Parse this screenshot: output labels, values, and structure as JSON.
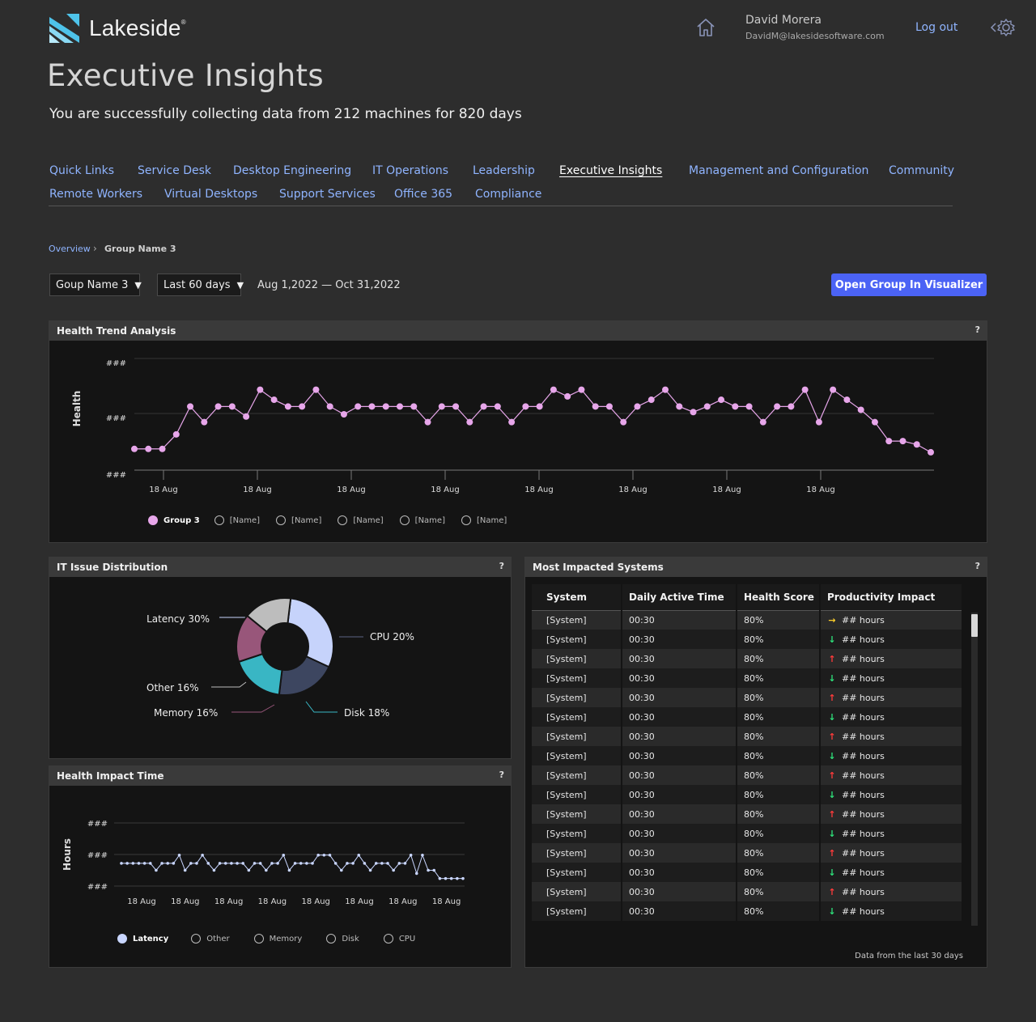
{
  "header": {
    "brand": "Lakeside",
    "user_name": "David Morera",
    "user_email": "DavidM@lakesidesoftware.com",
    "logout_label": "Log out",
    "icons": [
      "home-icon",
      "gear-icon"
    ]
  },
  "page": {
    "title": "Executive Insights",
    "subtitle": "You are successfully collecting data from 212 machines for 820 days"
  },
  "nav": {
    "row1": [
      "Quick Links",
      "Service Desk",
      "Desktop Engineering",
      "IT Operations",
      "Leadership",
      "Executive Insights",
      "Management and Configuration",
      "Community"
    ],
    "row2": [
      "Remote Workers",
      "Virtual Desktops",
      "Support Services",
      "Office 365",
      "Compliance"
    ],
    "active": "Executive Insights"
  },
  "breadcrumb": {
    "root": "Overview",
    "current": "Group Name 3"
  },
  "controls": {
    "group_select": "Goup Name 3",
    "period_select": "Last 60 days",
    "date_range": "Aug 1,2022 — Oct 31,2022",
    "open_button": "Open Group In Visualizer"
  },
  "health_trend": {
    "title": "Health Trend Analysis",
    "help": "?",
    "ylabel": "Health",
    "ytick_labels": [
      "###",
      "###",
      "###"
    ],
    "xtick_labels": [
      "18 Aug",
      "18 Aug",
      "18 Aug",
      "18 Aug",
      "18 Aug",
      "18 Aug",
      "18 Aug",
      "18 Aug"
    ],
    "legend": [
      "Group 3",
      "[Name]",
      "[Name]",
      "[Name]",
      "[Name]",
      "[Name]"
    ]
  },
  "issue_distribution": {
    "title": "IT Issue Distribution",
    "help": "?"
  },
  "impact_time": {
    "title": "Health Impact Time",
    "help": "?",
    "ylabel": "Hours",
    "ytick_labels": [
      "###",
      "###",
      "###"
    ],
    "xtick_labels": [
      "18 Aug",
      "18 Aug",
      "18 Aug",
      "18 Aug",
      "18 Aug",
      "18 Aug",
      "18 Aug",
      "18 Aug"
    ],
    "legend": [
      "Latency",
      "Other",
      "Memory",
      "Disk",
      "CPU"
    ]
  },
  "impacted": {
    "title": "Most Impacted Systems",
    "help": "?",
    "columns": [
      "System",
      "Daily Active Time",
      "Health Score",
      "Productivity Impact"
    ],
    "rows": [
      {
        "system": "[System]",
        "time": "00:30",
        "score": "80%",
        "trend": "flat",
        "impact": "## hours"
      },
      {
        "system": "[System]",
        "time": "00:30",
        "score": "80%",
        "trend": "down",
        "impact": "## hours"
      },
      {
        "system": "[System]",
        "time": "00:30",
        "score": "80%",
        "trend": "up",
        "impact": "## hours"
      },
      {
        "system": "[System]",
        "time": "00:30",
        "score": "80%",
        "trend": "down",
        "impact": "## hours"
      },
      {
        "system": "[System]",
        "time": "00:30",
        "score": "80%",
        "trend": "up",
        "impact": "## hours"
      },
      {
        "system": "[System]",
        "time": "00:30",
        "score": "80%",
        "trend": "down",
        "impact": "## hours"
      },
      {
        "system": "[System]",
        "time": "00:30",
        "score": "80%",
        "trend": "up",
        "impact": "## hours"
      },
      {
        "system": "[System]",
        "time": "00:30",
        "score": "80%",
        "trend": "down",
        "impact": "## hours"
      },
      {
        "system": "[System]",
        "time": "00:30",
        "score": "80%",
        "trend": "up",
        "impact": "## hours"
      },
      {
        "system": "[System]",
        "time": "00:30",
        "score": "80%",
        "trend": "down",
        "impact": "## hours"
      },
      {
        "system": "[System]",
        "time": "00:30",
        "score": "80%",
        "trend": "up",
        "impact": "## hours"
      },
      {
        "system": "[System]",
        "time": "00:30",
        "score": "80%",
        "trend": "down",
        "impact": "## hours"
      },
      {
        "system": "[System]",
        "time": "00:30",
        "score": "80%",
        "trend": "up",
        "impact": "## hours"
      },
      {
        "system": "[System]",
        "time": "00:30",
        "score": "80%",
        "trend": "down",
        "impact": "## hours"
      },
      {
        "system": "[System]",
        "time": "00:30",
        "score": "80%",
        "trend": "up",
        "impact": "## hours"
      },
      {
        "system": "[System]",
        "time": "00:30",
        "score": "80%",
        "trend": "down",
        "impact": "## hours"
      }
    ],
    "footnote": "Data from the  last 30 days"
  },
  "colors": {
    "accent": "#4b63f5",
    "link": "#8fb4ff",
    "trend_line": "#e7a6ea",
    "impact_line": "#c9d6ff",
    "up": "#ff3b3b",
    "down": "#2ee07a",
    "flat": "#ffd02a"
  },
  "chart_data": [
    {
      "type": "line",
      "title": "Health Trend Analysis",
      "ylabel": "Health",
      "x_tick_labels": [
        "18 Aug",
        "18 Aug",
        "18 Aug",
        "18 Aug",
        "18 Aug",
        "18 Aug",
        "18 Aug",
        "18 Aug"
      ],
      "y_tick_labels": [
        "###",
        "###",
        "###"
      ],
      "ylim": [
        0,
        100
      ],
      "series": [
        {
          "name": "Group 3",
          "color": "#e7a6ea",
          "values": [
            19,
            19,
            19,
            32,
            57,
            43,
            57,
            57,
            48,
            72,
            63,
            57,
            57,
            72,
            57,
            50,
            57,
            57,
            57,
            57,
            57,
            43,
            57,
            57,
            43,
            57,
            57,
            43,
            57,
            57,
            72,
            66,
            72,
            57,
            57,
            43,
            57,
            63,
            72,
            57,
            52,
            57,
            63,
            57,
            57,
            43,
            57,
            57,
            72,
            43,
            72,
            63,
            54,
            43,
            26,
            26,
            23,
            16
          ]
        }
      ],
      "legend": [
        "Group 3",
        "[Name]",
        "[Name]",
        "[Name]",
        "[Name]",
        "[Name]"
      ],
      "grid": true
    },
    {
      "type": "pie",
      "title": "IT Issue Distribution",
      "donut": true,
      "slices": [
        {
          "label": "Latency 30%",
          "value": 30,
          "color": "#c6d3fb"
        },
        {
          "label": "CPU 20%",
          "value": 20,
          "color": "#3d4660"
        },
        {
          "label": "Disk 18%",
          "value": 18,
          "color": "#39b6c4"
        },
        {
          "label": "Memory 16%",
          "value": 16,
          "color": "#98567a"
        },
        {
          "label": "Other 16%",
          "value": 16,
          "color": "#bdbdbd"
        }
      ]
    },
    {
      "type": "line",
      "title": "Health Impact Time",
      "ylabel": "Hours",
      "x_tick_labels": [
        "18 Aug",
        "18 Aug",
        "18 Aug",
        "18 Aug",
        "18 Aug",
        "18 Aug",
        "18 Aug",
        "18 Aug"
      ],
      "y_tick_labels": [
        "###",
        "###",
        "###"
      ],
      "ylim": [
        0,
        100
      ],
      "series": [
        {
          "name": "Latency",
          "color": "#c9d6ff",
          "values": [
            36,
            36,
            36,
            36,
            36,
            36,
            25,
            36,
            36,
            36,
            49,
            25,
            36,
            36,
            49,
            36,
            25,
            36,
            36,
            36,
            36,
            36,
            25,
            36,
            36,
            25,
            36,
            36,
            49,
            25,
            36,
            36,
            36,
            36,
            49,
            49,
            49,
            36,
            25,
            36,
            36,
            49,
            36,
            25,
            36,
            36,
            36,
            25,
            36,
            36,
            49,
            20,
            49,
            25,
            25,
            12,
            12,
            12,
            12,
            12
          ]
        }
      ],
      "legend": [
        "Latency",
        "Other",
        "Memory",
        "Disk",
        "CPU"
      ],
      "grid": true
    }
  ]
}
